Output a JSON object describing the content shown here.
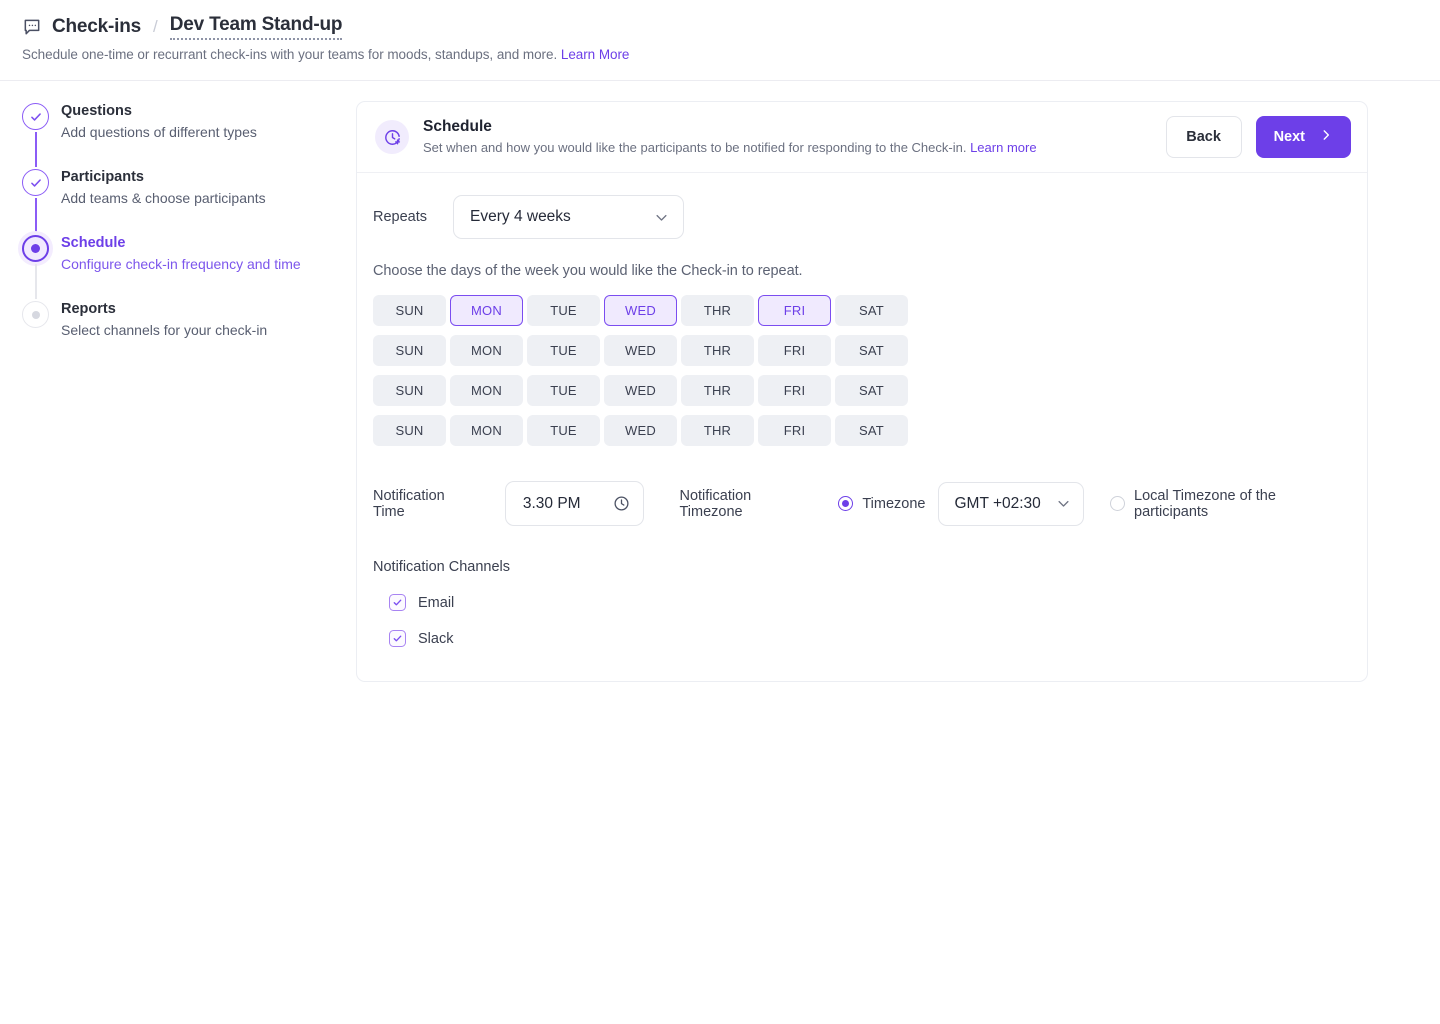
{
  "header": {
    "chat_icon": "chat-icon",
    "root": "Check-ins",
    "separator": "/",
    "current": "Dev Team Stand-up",
    "subtitle": "Schedule one-time or recurrant check-ins with your teams for moods, standups, and more.",
    "subtitle_link": "Learn More"
  },
  "stepper": {
    "steps": [
      {
        "title": "Questions",
        "desc": "Add questions of different types",
        "state": "done"
      },
      {
        "title": "Participants",
        "desc": "Add teams & choose participants",
        "state": "done"
      },
      {
        "title": "Schedule",
        "desc": "Configure check-in frequency and time",
        "state": "active"
      },
      {
        "title": "Reports",
        "desc": "Select channels for your check-in",
        "state": "todo"
      }
    ]
  },
  "card": {
    "icon": "clock-plus-icon",
    "title": "Schedule",
    "subtitle": "Set when and how you would like the participants to be notified for responding to the Check-in.",
    "subtitle_link": "Learn more",
    "back_label": "Back",
    "next_label": "Next"
  },
  "schedule": {
    "repeats_label": "Repeats",
    "repeats_value": "Every 4 weeks",
    "help_text": "Choose the days of the week you would like the Check-in to repeat.",
    "day_rows": [
      [
        {
          "label": "SUN",
          "selected": false
        },
        {
          "label": "MON",
          "selected": true
        },
        {
          "label": "TUE",
          "selected": false
        },
        {
          "label": "WED",
          "selected": true
        },
        {
          "label": "THR",
          "selected": false
        },
        {
          "label": "FRI",
          "selected": true
        },
        {
          "label": "SAT",
          "selected": false
        }
      ],
      [
        {
          "label": "SUN",
          "selected": false
        },
        {
          "label": "MON",
          "selected": false
        },
        {
          "label": "TUE",
          "selected": false
        },
        {
          "label": "WED",
          "selected": false
        },
        {
          "label": "THR",
          "selected": false
        },
        {
          "label": "FRI",
          "selected": false
        },
        {
          "label": "SAT",
          "selected": false
        }
      ],
      [
        {
          "label": "SUN",
          "selected": false
        },
        {
          "label": "MON",
          "selected": false
        },
        {
          "label": "TUE",
          "selected": false
        },
        {
          "label": "WED",
          "selected": false
        },
        {
          "label": "THR",
          "selected": false
        },
        {
          "label": "FRI",
          "selected": false
        },
        {
          "label": "SAT",
          "selected": false
        }
      ],
      [
        {
          "label": "SUN",
          "selected": false
        },
        {
          "label": "MON",
          "selected": false
        },
        {
          "label": "TUE",
          "selected": false
        },
        {
          "label": "WED",
          "selected": false
        },
        {
          "label": "THR",
          "selected": false
        },
        {
          "label": "FRI",
          "selected": false
        },
        {
          "label": "SAT",
          "selected": false
        }
      ]
    ],
    "notification_time_label": "Notification Time",
    "notification_time_value": "3.30 PM",
    "notification_timezone_label": "Notification Timezone",
    "timezone_radio_label": "Timezone",
    "timezone_radio_selected": true,
    "timezone_value": "GMT +02:30",
    "local_radio_label": "Local Timezone of the participants",
    "local_radio_selected": false,
    "channels_label": "Notification Channels",
    "channels": [
      {
        "label": "Email",
        "checked": true
      },
      {
        "label": "Slack",
        "checked": true
      }
    ]
  },
  "colors": {
    "accent": "#6d3fe8",
    "accent_soft": "#f0eafe",
    "day_bg": "#eef0f4",
    "text": "#2b2f3a",
    "muted": "#6b7080"
  }
}
